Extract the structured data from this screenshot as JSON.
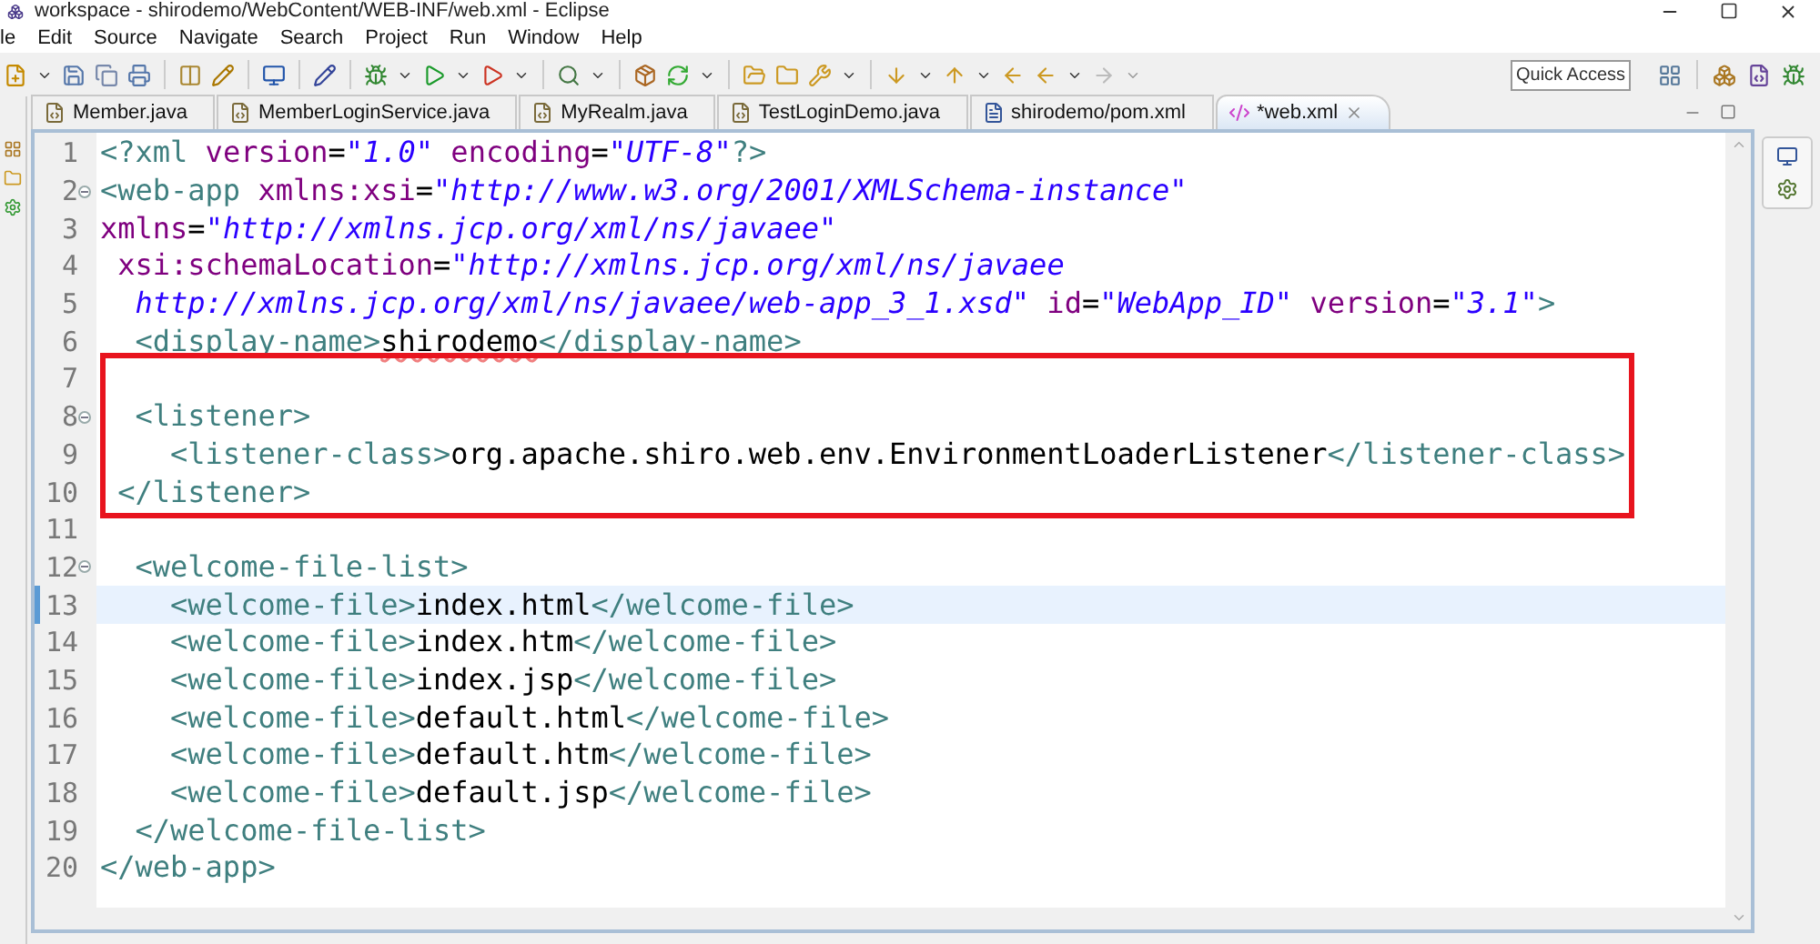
{
  "window": {
    "title": "workspace - shirodemo/WebContent/WEB-INF/web.xml - Eclipse"
  },
  "menu": [
    "le",
    "Edit",
    "Source",
    "Navigate",
    "Search",
    "Project",
    "Run",
    "Window",
    "Help"
  ],
  "quick_access": {
    "placeholder": "Quick Access"
  },
  "tabs": [
    {
      "label": "Member.java",
      "kind": "java",
      "selected": false
    },
    {
      "label": "MemberLoginService.java",
      "kind": "java",
      "selected": false
    },
    {
      "label": "MyRealm.java",
      "kind": "java",
      "selected": false
    },
    {
      "label": "TestLoginDemo.java",
      "kind": "java",
      "selected": false
    },
    {
      "label": "shirodemo/pom.xml",
      "kind": "pom",
      "selected": false
    },
    {
      "label": "*web.xml",
      "kind": "xml",
      "selected": true
    }
  ],
  "annotation": {
    "kind": "rectangle"
  },
  "lines": [
    {
      "number": "1",
      "foldable": false,
      "current": false,
      "tokens": [
        {
          "kind": "tag",
          "text": "<?xml"
        },
        {
          "kind": "attr",
          "text": " version"
        },
        {
          "kind": "plain",
          "text": "="
        },
        {
          "kind": "value",
          "text": "\"1.0\""
        },
        {
          "kind": "attr",
          "text": " encoding"
        },
        {
          "kind": "plain",
          "text": "="
        },
        {
          "kind": "value",
          "text": "\"UTF-8\""
        },
        {
          "kind": "tag",
          "text": "?>"
        }
      ]
    },
    {
      "number": "2",
      "foldable": true,
      "current": false,
      "tokens": [
        {
          "kind": "tag",
          "text": "<web-app"
        },
        {
          "kind": "attr",
          "text": " xmlns:xsi"
        },
        {
          "kind": "plain",
          "text": "="
        },
        {
          "kind": "value",
          "text": "\"http://www.w3.org/2001/XMLSchema-instance\""
        }
      ]
    },
    {
      "number": "3",
      "foldable": false,
      "current": false,
      "tokens": [
        {
          "kind": "attr",
          "text": "xmlns"
        },
        {
          "kind": "plain",
          "text": "="
        },
        {
          "kind": "value",
          "text": "\"http://xmlns.jcp.org/xml/ns/javaee\""
        }
      ]
    },
    {
      "number": "4",
      "foldable": false,
      "current": false,
      "tokens": [
        {
          "kind": "attr",
          "text": " xsi:schemaLocation"
        },
        {
          "kind": "plain",
          "text": "="
        },
        {
          "kind": "value",
          "text": "\"http://xmlns.jcp.org/xml/ns/javaee"
        }
      ]
    },
    {
      "number": "5",
      "foldable": false,
      "current": false,
      "tokens": [
        {
          "kind": "value",
          "text": "  http://xmlns.jcp.org/xml/ns/javaee/web-app_3_1.xsd\""
        },
        {
          "kind": "attr",
          "text": " id"
        },
        {
          "kind": "plain",
          "text": "="
        },
        {
          "kind": "value",
          "text": "\"WebApp_ID\""
        },
        {
          "kind": "attr",
          "text": " version"
        },
        {
          "kind": "plain",
          "text": "="
        },
        {
          "kind": "value",
          "text": "\"3.1\""
        },
        {
          "kind": "tag",
          "text": ">"
        }
      ]
    },
    {
      "number": "6",
      "foldable": false,
      "current": false,
      "tokens": [
        {
          "kind": "tag",
          "text": "  <display-name>"
        },
        {
          "kind": "misspelled",
          "text": "shirodemo"
        },
        {
          "kind": "tag",
          "text": "</display-name>"
        }
      ]
    },
    {
      "number": "7",
      "foldable": false,
      "current": false
    },
    {
      "number": "8",
      "foldable": true,
      "current": false,
      "tokens": [
        {
          "kind": "tag",
          "text": "  <listener>"
        }
      ]
    },
    {
      "number": "9",
      "foldable": false,
      "current": false,
      "tokens": [
        {
          "kind": "tag",
          "text": "    <listener-class>"
        },
        {
          "kind": "plain",
          "text": "org.apache.shiro.web.env.EnvironmentLoaderListener"
        },
        {
          "kind": "tag",
          "text": "</listener-class>"
        }
      ]
    },
    {
      "number": "10",
      "foldable": false,
      "current": false,
      "tokens": [
        {
          "kind": "tag",
          "text": " </listener>"
        }
      ]
    },
    {
      "number": "11",
      "foldable": false,
      "current": false
    },
    {
      "number": "12",
      "foldable": true,
      "current": false,
      "tokens": [
        {
          "kind": "tag",
          "text": "  <welcome-file-list>"
        }
      ]
    },
    {
      "number": "13",
      "foldable": false,
      "current": true,
      "tokens": [
        {
          "kind": "tag",
          "text": "    <welcome-file>"
        },
        {
          "kind": "plain",
          "text": "index.html"
        },
        {
          "kind": "tag",
          "text": "</welcome-file>"
        }
      ]
    },
    {
      "number": "14",
      "foldable": false,
      "current": false,
      "tokens": [
        {
          "kind": "tag",
          "text": "    <welcome-file>"
        },
        {
          "kind": "plain",
          "text": "index.htm"
        },
        {
          "kind": "tag",
          "text": "</welcome-file>"
        }
      ]
    },
    {
      "number": "15",
      "foldable": false,
      "current": false,
      "tokens": [
        {
          "kind": "tag",
          "text": "    <welcome-file>"
        },
        {
          "kind": "plain",
          "text": "index.jsp"
        },
        {
          "kind": "tag",
          "text": "</welcome-file>"
        }
      ]
    },
    {
      "number": "16",
      "foldable": false,
      "current": false,
      "tokens": [
        {
          "kind": "tag",
          "text": "    <welcome-file>"
        },
        {
          "kind": "plain",
          "text": "default.html"
        },
        {
          "kind": "tag",
          "text": "</welcome-file>"
        }
      ]
    },
    {
      "number": "17",
      "foldable": false,
      "current": false,
      "tokens": [
        {
          "kind": "tag",
          "text": "    <welcome-file>"
        },
        {
          "kind": "plain",
          "text": "default.htm"
        },
        {
          "kind": "tag",
          "text": "</welcome-file>"
        }
      ]
    },
    {
      "number": "18",
      "foldable": false,
      "current": false,
      "tokens": [
        {
          "kind": "tag",
          "text": "    <welcome-file>"
        },
        {
          "kind": "plain",
          "text": "default.jsp"
        },
        {
          "kind": "tag",
          "text": "</welcome-file>"
        }
      ]
    },
    {
      "number": "19",
      "foldable": false,
      "current": false,
      "tokens": [
        {
          "kind": "tag",
          "text": "  </welcome-file-list>"
        }
      ]
    },
    {
      "number": "20",
      "foldable": false,
      "current": false,
      "tokens": [
        {
          "kind": "tag",
          "text": "</web-app>"
        }
      ]
    }
  ]
}
